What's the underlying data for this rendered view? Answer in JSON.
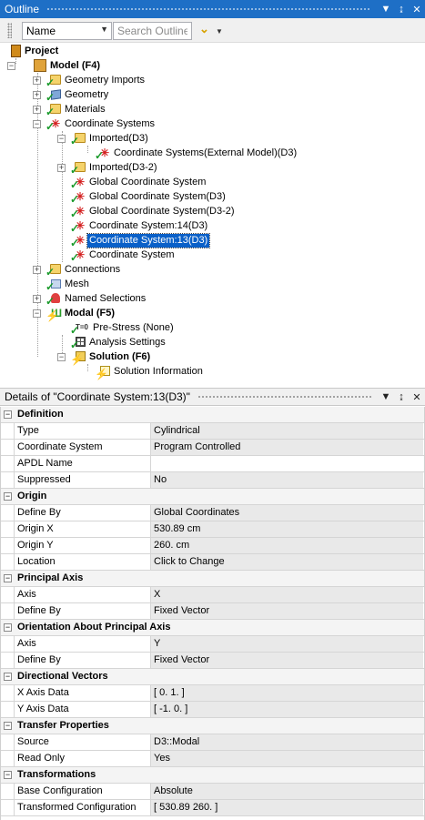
{
  "outline": {
    "title": "Outline",
    "window_buttons": [
      "▼",
      "↨",
      "✕"
    ],
    "name_select": "Name",
    "search_placeholder": "Search Outline"
  },
  "tree": {
    "project": "Project",
    "model": "Model (F4)",
    "geometry_imports": "Geometry Imports",
    "geometry": "Geometry",
    "materials": "Materials",
    "coordinate_systems": "Coordinate Systems",
    "imported_d3": "Imported(D3)",
    "cs_external": "Coordinate Systems(External Model)(D3)",
    "imported_d3_2": "Imported(D3-2)",
    "global_cs": "Global Coordinate System",
    "global_cs_d3": "Global Coordinate System(D3)",
    "global_cs_d3_2": "Global Coordinate System(D3-2)",
    "cs_14": "Coordinate System:14(D3)",
    "cs_13": "Coordinate System:13(D3)",
    "cs": "Coordinate System",
    "connections": "Connections",
    "mesh": "Mesh",
    "named_selections": "Named Selections",
    "modal": "Modal (F5)",
    "prestress": "Pre-Stress (None)",
    "analysis_settings": "Analysis Settings",
    "solution": "Solution (F6)",
    "solution_info": "Solution Information"
  },
  "details": {
    "title": "Details of \"Coordinate System:13(D3)\"",
    "sections": [
      {
        "title": "Definition",
        "rows": [
          {
            "k": "Type",
            "v": "Cylindrical"
          },
          {
            "k": "Coordinate System",
            "v": "Program Controlled"
          },
          {
            "k": "APDL Name",
            "v": ""
          },
          {
            "k": "Suppressed",
            "v": "No"
          }
        ]
      },
      {
        "title": "Origin",
        "rows": [
          {
            "k": "Define By",
            "v": "Global Coordinates"
          },
          {
            "k": "Origin X",
            "v": "530.89 cm"
          },
          {
            "k": "Origin Y",
            "v": "260. cm"
          },
          {
            "k": "Location",
            "v": "Click to Change"
          }
        ]
      },
      {
        "title": "Principal Axis",
        "rows": [
          {
            "k": "Axis",
            "v": "X"
          },
          {
            "k": "Define By",
            "v": "Fixed Vector"
          }
        ]
      },
      {
        "title": "Orientation About Principal Axis",
        "rows": [
          {
            "k": "Axis",
            "v": "Y"
          },
          {
            "k": "Define By",
            "v": "Fixed Vector"
          }
        ]
      },
      {
        "title": "Directional Vectors",
        "rows": [
          {
            "k": "X Axis Data",
            "v": "[  0.   1.  ]"
          },
          {
            "k": "Y Axis Data",
            "v": "[  -1.   0.  ]"
          }
        ]
      },
      {
        "title": "Transfer Properties",
        "rows": [
          {
            "k": "Source",
            "v": "D3::Modal"
          },
          {
            "k": "Read Only",
            "v": "Yes"
          }
        ]
      },
      {
        "title": "Transformations",
        "rows": [
          {
            "k": "Base Configuration",
            "v": "Absolute"
          },
          {
            "k": "Transformed Configuration",
            "v": "[  530.89  260.  ]"
          }
        ]
      }
    ]
  }
}
